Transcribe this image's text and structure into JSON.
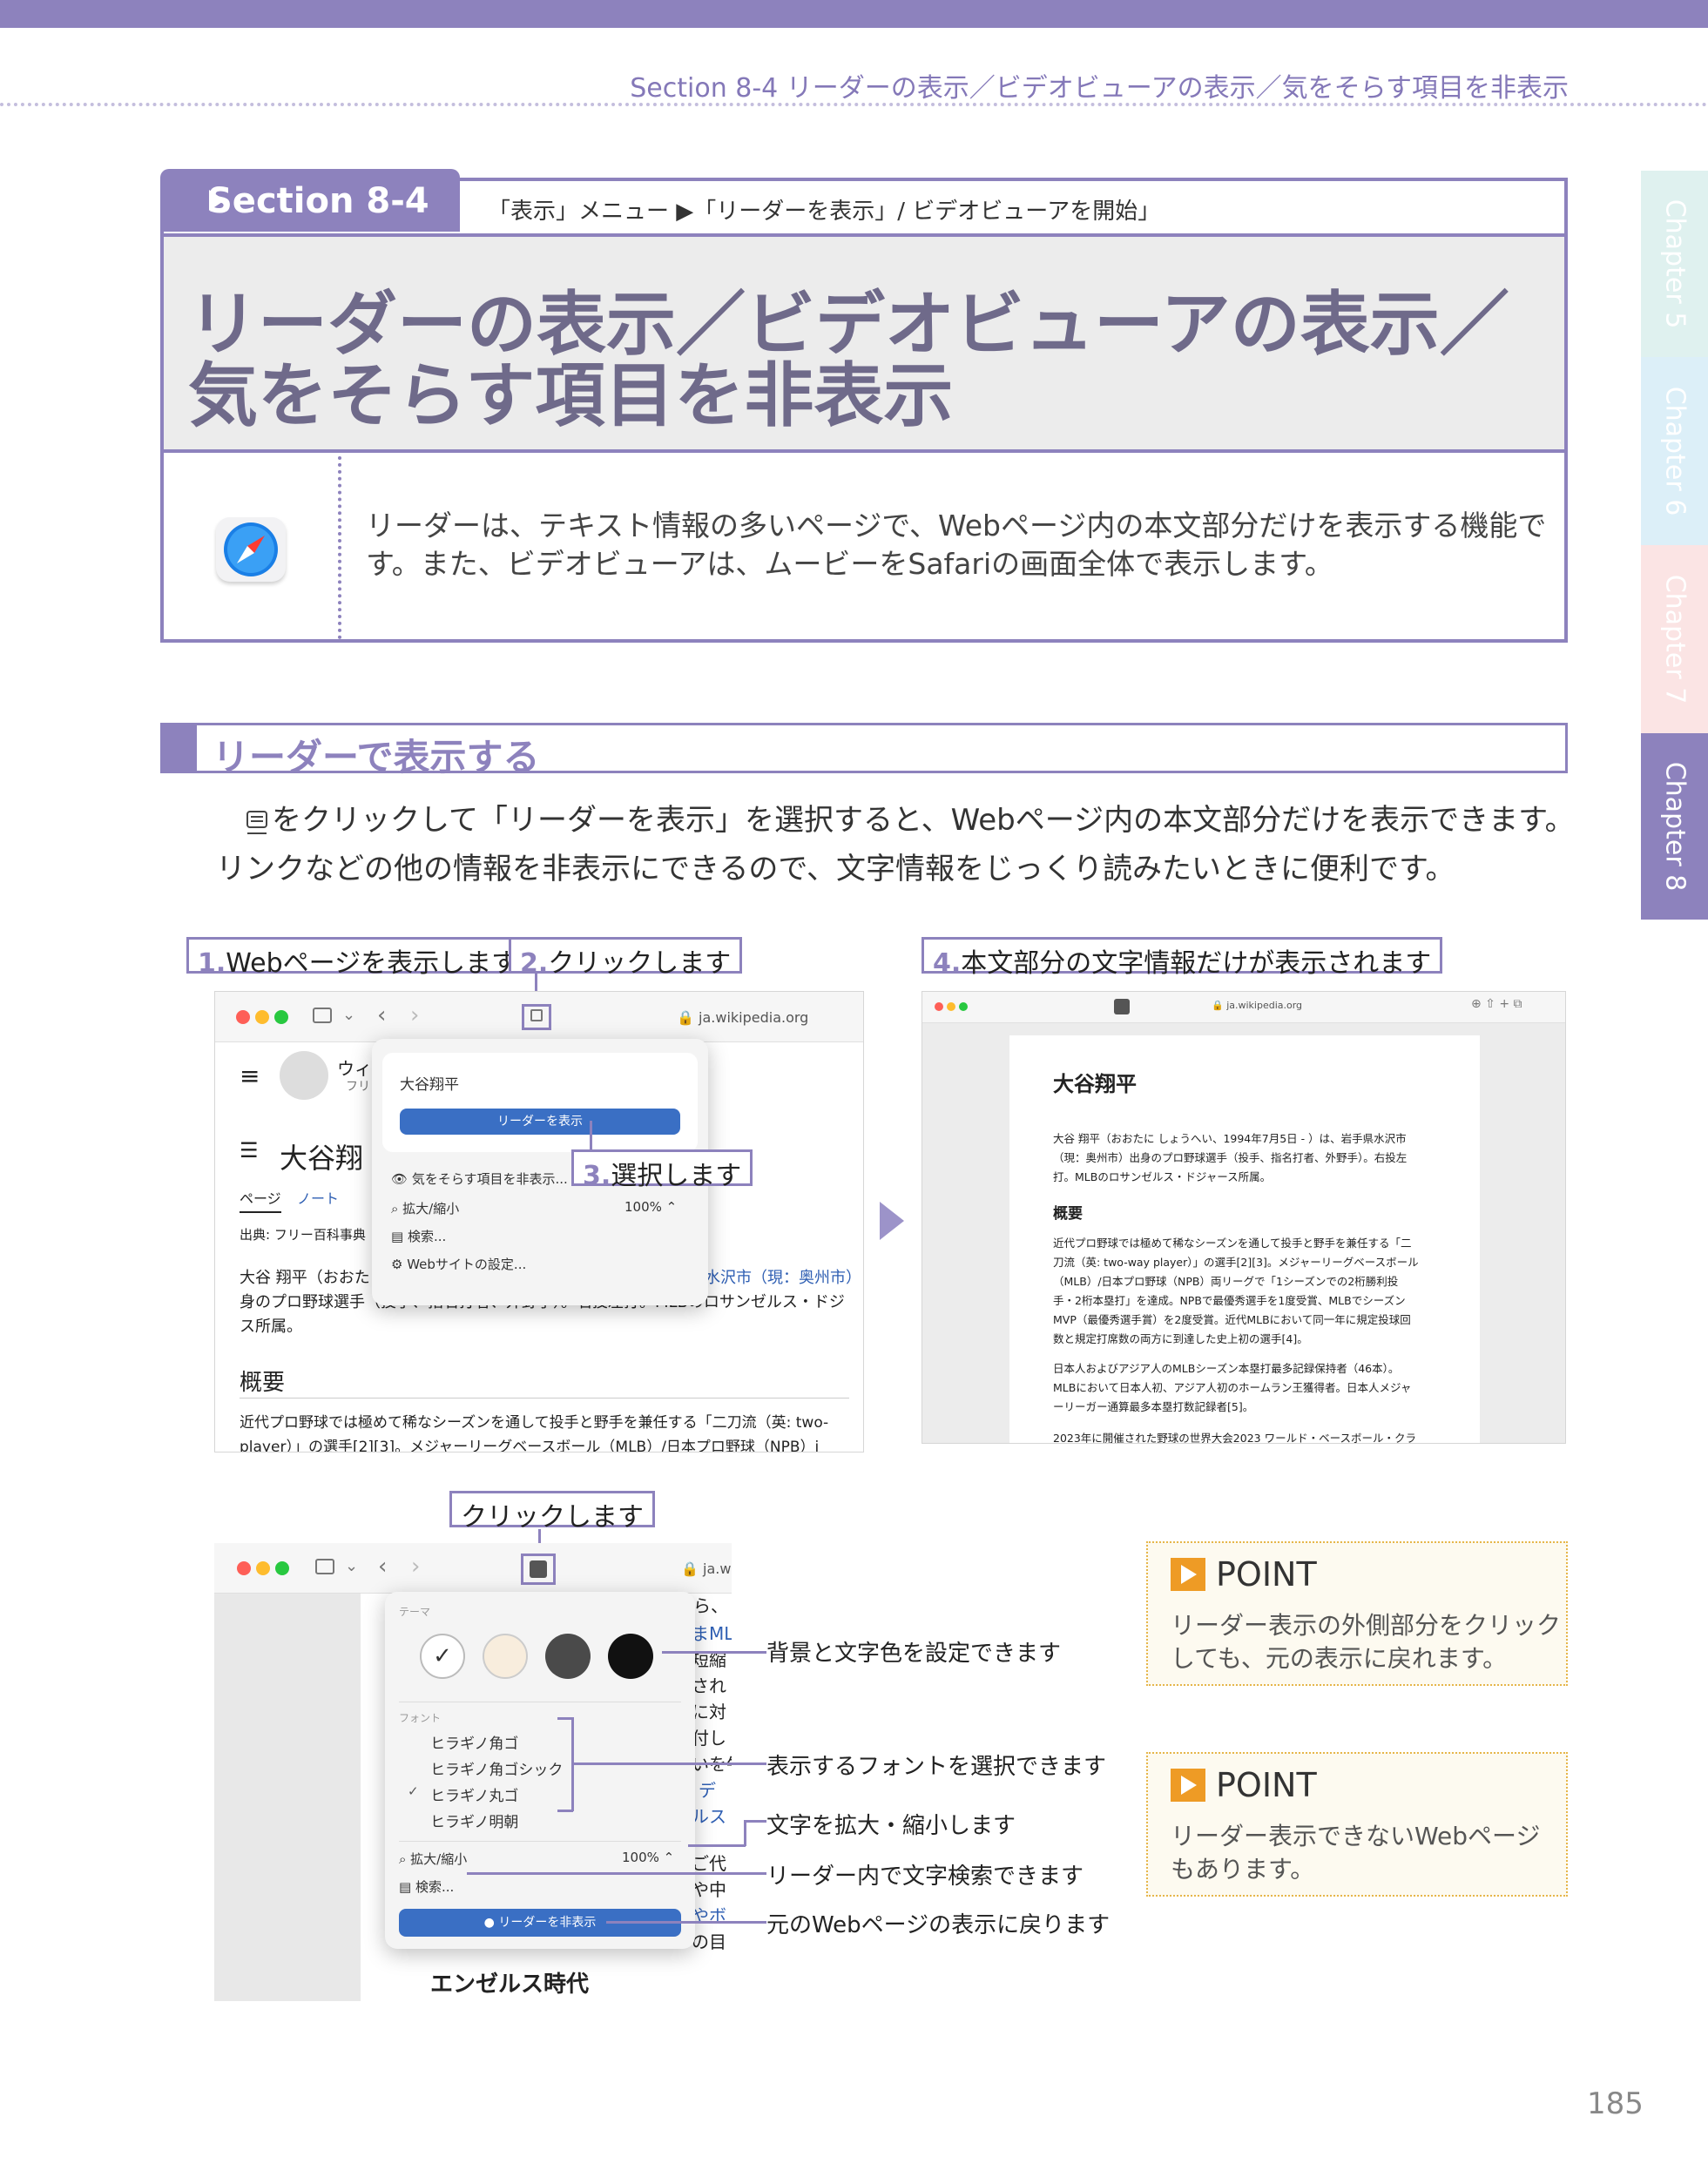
{
  "running_header": "Section 8-4 リーダーの表示／ビデオビューアの表示／気をそらす項目を非表示",
  "chapter_tabs": [
    {
      "label": "Chapter 5",
      "color": "#dff1ef"
    },
    {
      "label": "Chapter 6",
      "color": "#dceff8"
    },
    {
      "label": "Chapter 7",
      "color": "#fbe4e4"
    },
    {
      "label": "Chapter 8",
      "color": "#8d82bd"
    }
  ],
  "section": {
    "tab_label": "Section 8-4",
    "menu_path": "「表示」メニュー ▶「リーダーを表示」/ ビデオビューアを開始」",
    "title_line1": "リーダーの表示／ビデオビューアの表示／",
    "title_line2": "気をそらす項目を非表示",
    "intro": "リーダーは、テキスト情報の多いページで、Webページ内の本文部分だけを表示する機能です。また、ビデオビューアは、ムービーをSafariの画面全体で表示します。"
  },
  "heading": "リーダーで表示する",
  "body_text": "をクリックして「リーダーを表示」を選択すると、Webページ内の本文部分だけを表示できます。リンクなどの他の情報を非表示にできるので、文字情報をじっくり読みたいときに便利です。",
  "steps": [
    {
      "num": "1.",
      "label": "Webページを表示します"
    },
    {
      "num": "2.",
      "label": "クリックします"
    },
    {
      "num": "3.",
      "label": "選択します"
    },
    {
      "num": "4.",
      "label": "本文部分の文字情報だけが表示されます"
    }
  ],
  "shot1": {
    "url": "ja.wikipedia.org",
    "wiki_title": "ウィ",
    "wiki_sub": "フリ",
    "article_title": "大谷翔",
    "popup_title": "大谷翔平",
    "reader_btn": "リーダーを表示",
    "menu_items": [
      "気をそらす項目を非表示...",
      "拡大/縮小",
      "検索...",
      "Webサイトの設定..."
    ],
    "zoom_value": "100% ⌃",
    "tabs": [
      "ページ",
      "ノート"
    ],
    "source": "出典: フリー百科事典",
    "para1_a": "大谷 翔平（おおた",
    "para1_b": "県水沢市（現：奥州市）",
    "para2": "身のプロ野球選手（投手、指名打者、外野手）。右投左打。MLBのロサンゼルス・ドジ",
    "para3": "ス所属。",
    "overview": "概要",
    "para4": "近代プロ野球では極めて稀なシーズンを通して投手と野手を兼任する「二刀流（英: two-",
    "para5": "player）」の選手[2][3]。メジャーリーグベースボール（MLB）/日本プロ野球（NPB）i"
  },
  "shot2": {
    "url": "ja.wikipedia.org",
    "title": "大谷翔平",
    "p1": [
      "大谷 翔平（おおたに しょうへい、1994年7月5日 - ）は、岩手県水沢市",
      "（現：奥州市）出身のプロ野球選手（投手、指名打者、外野手）。右投左",
      "打。MLBのロサンゼルス・ドジャース所属。"
    ],
    "overview": "概要",
    "p2": [
      "近代プロ野球では極めて稀なシーズンを通して投手と野手を兼任する「二",
      "刀流（英: two-way player）」の選手[2][3]。メジャーリーグベースボール",
      "（MLB）/日本プロ野球（NPB）両リーグで「1シーズンでの2桁勝利投",
      "手・2桁本塁打」を達成。NPBで最優秀選手を1度受賞、MLBでシーズン",
      "MVP（最優秀選手賞）を2度受賞。近代MLBにおいて同一年に規定投球回",
      "数と規定打席数の両方に到達した史上初の選手[4]。"
    ],
    "p3": [
      "日本人およびアジア人のMLBシーズン本塁打最多記録保持者（46本）。",
      "MLBにおいて日本人初、アジア人初のホームラン王獲得者。日本人メジャ",
      "ーリーガー通算最多本塁打数記録者[5]。"
    ],
    "p4": "2023年に開催された野球の世界大会2023 ワールド・ベースボール・クラ"
  },
  "shot3": {
    "click_label": "クリックします",
    "url": "ja.wiki",
    "theme_label": "テーマ",
    "font_label": "フォント",
    "fonts": [
      "ヒラギノ角ゴ",
      "ヒラギノ角ゴシック",
      "ヒラギノ丸ゴ",
      "ヒラギノ明朝"
    ],
    "checked_font_index": 2,
    "zoom_label": "拡大/縮小",
    "zoom_value": "100% ⌃",
    "search_label": "検索...",
    "hide_btn": "リーダーを非表示",
    "bottom_text": "エンゼルス時代",
    "side_fragments": [
      "ら、",
      "まML",
      "短縮",
      "され",
      "に対",
      "付し",
      "いを牛",
      "デ",
      "ルス",
      "ご代",
      "や中",
      "やボ",
      "の目"
    ],
    "theme_colors": [
      "#ffffff",
      "#f8eddd",
      "#4a4a4a",
      "#111111"
    ]
  },
  "callouts": [
    "背景と文字色を設定できます",
    "表示するフォントを選択できます",
    "文字を拡大・縮小します",
    "リーダー内で文字検索できます",
    "元のWebページの表示に戻ります"
  ],
  "points": [
    {
      "head": "POINT",
      "body": "リーダー表示の外側部分をクリックしても、元の表示に戻れます。"
    },
    {
      "head": "POINT",
      "body": "リーダー表示できないWebページもあります。"
    }
  ],
  "page_number": "185"
}
